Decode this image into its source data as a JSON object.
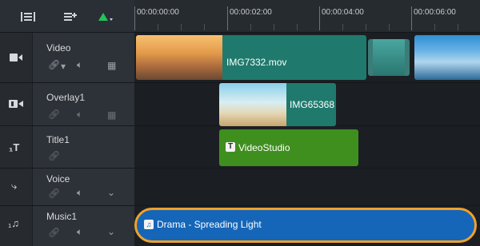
{
  "ruler": {
    "ticks": [
      "00:00:00:00",
      "00:00:02:00",
      "00:00:04:00",
      "00:00:06:00"
    ]
  },
  "tracks": [
    {
      "name": "Video",
      "type": "video"
    },
    {
      "name": "Overlay1",
      "type": "overlay"
    },
    {
      "name": "Title1",
      "type": "title"
    },
    {
      "name": "Voice",
      "type": "voice"
    },
    {
      "name": "Music1",
      "type": "music"
    }
  ],
  "clips": {
    "video_main": "IMG7332.mov",
    "overlay": "IMG65368",
    "title": "VideoStudio",
    "music": "Drama - Spreading Light"
  },
  "colors": {
    "video_clip": "#1f7a6d",
    "overlay_clip": "#1f7a6d",
    "title_clip": "#3f8f1f",
    "music_clip": "#1566b8",
    "highlight": "#f0a12b",
    "toolbar_accent": "#23c35a"
  },
  "icons": {
    "toolbar": [
      "track-manager-icon",
      "chapter-cue-icon",
      "add-marker-icon"
    ],
    "video": "video-camera-icon",
    "overlay": "overlay-track-icon",
    "title": "title-text-icon",
    "voice": "microphone-icon",
    "music": "music-note-icon"
  }
}
